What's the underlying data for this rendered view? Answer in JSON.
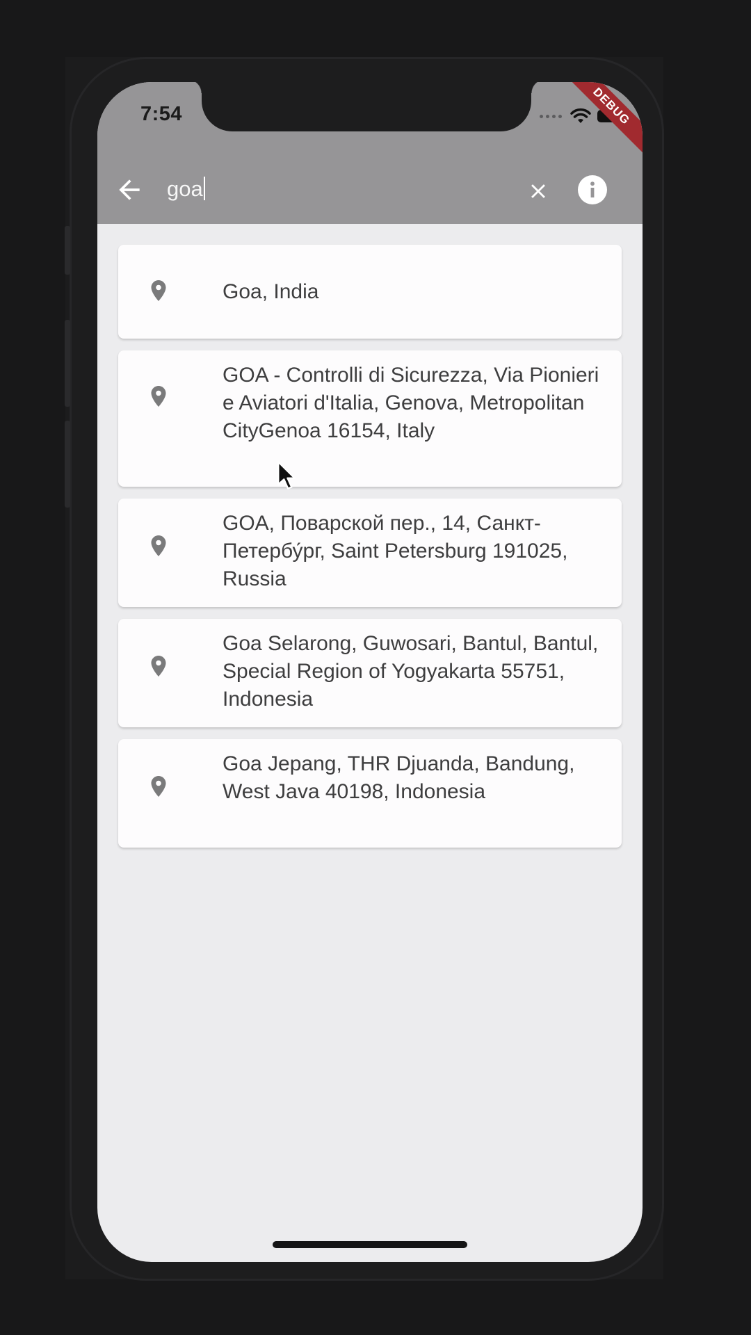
{
  "status_bar": {
    "time": "7:54",
    "debug_banner": "DEBUG"
  },
  "search_bar": {
    "back_icon": "arrow-left-icon",
    "query": "goa",
    "clear_icon": "close-icon",
    "info_icon": "info-icon"
  },
  "results": [
    {
      "icon": "location-pin-icon",
      "address": "Goa, India"
    },
    {
      "icon": "location-pin-icon",
      "address": "GOA - Controlli di Sicurezza, Via Pionieri e Aviatori d'Italia, Genova, Metropolitan CityGenoa 16154, Italy"
    },
    {
      "icon": "location-pin-icon",
      "address": "GOA, Поварской пер., 14, Санкт-Петербу́рг, Saint Petersburg 191025, Russia"
    },
    {
      "icon": "location-pin-icon",
      "address": "Goa Selarong, Guwosari, Bantul, Bantul, Special Region of Yogyakarta 55751, Indonesia"
    },
    {
      "icon": "location-pin-icon",
      "address": "Goa Jepang, THR Djuanda, Bandung, West Java 40198, Indonesia"
    }
  ],
  "colors": {
    "app_bar": "#969597",
    "background": "#ececee",
    "card": "#fdfcfd",
    "text": "#3e3e3f",
    "icon": "#7a7a7b",
    "debug_ribbon": "#a12a2f"
  }
}
